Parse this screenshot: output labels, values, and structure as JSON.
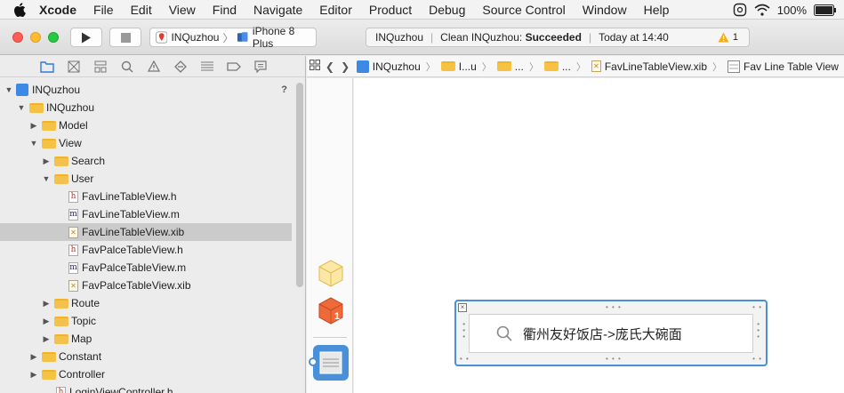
{
  "menubar": {
    "app_name": "Xcode",
    "items": [
      "File",
      "Edit",
      "View",
      "Find",
      "Navigate",
      "Editor",
      "Product",
      "Debug",
      "Source Control",
      "Window",
      "Help"
    ],
    "battery": "100%"
  },
  "toolbar": {
    "scheme": "INQuzhou",
    "device": "iPhone 8 Plus",
    "status_project": "INQuzhou",
    "status_action": "Clean INQuzhou:",
    "status_result": "Succeeded",
    "status_time": "Today at 14:40",
    "warning_count": "1"
  },
  "navigator": {
    "rows": [
      {
        "label": "INQuzhou",
        "type": "project",
        "indent": 0,
        "expanded": true,
        "selected": false
      },
      {
        "label": "INQuzhou",
        "type": "folder",
        "indent": 1,
        "expanded": true,
        "selected": false
      },
      {
        "label": "Model",
        "type": "folder",
        "indent": 2,
        "expanded": false,
        "selected": false
      },
      {
        "label": "View",
        "type": "folder",
        "indent": 2,
        "expanded": true,
        "selected": false
      },
      {
        "label": "Search",
        "type": "group",
        "indent": 3,
        "expanded": false,
        "selected": false
      },
      {
        "label": "User",
        "type": "group",
        "indent": 3,
        "expanded": true,
        "selected": false
      },
      {
        "label": "FavLineTableView.h",
        "type": "h",
        "indent": 4,
        "selected": false
      },
      {
        "label": "FavLineTableView.m",
        "type": "m",
        "indent": 4,
        "selected": false
      },
      {
        "label": "FavLineTableView.xib",
        "type": "xib",
        "indent": 4,
        "selected": true
      },
      {
        "label": "FavPalceTableView.h",
        "type": "h",
        "indent": 4,
        "selected": false
      },
      {
        "label": "FavPalceTableView.m",
        "type": "m",
        "indent": 4,
        "selected": false
      },
      {
        "label": "FavPalceTableView.xib",
        "type": "xib",
        "indent": 4,
        "selected": false
      },
      {
        "label": "Route",
        "type": "group",
        "indent": 3,
        "expanded": false,
        "selected": false
      },
      {
        "label": "Topic",
        "type": "group",
        "indent": 3,
        "expanded": false,
        "selected": false
      },
      {
        "label": "Map",
        "type": "group",
        "indent": 3,
        "expanded": false,
        "selected": false
      },
      {
        "label": "Constant",
        "type": "folder",
        "indent": 2,
        "expanded": false,
        "selected": false
      },
      {
        "label": "Controller",
        "type": "folder",
        "indent": 2,
        "expanded": false,
        "selected": false
      },
      {
        "label": "LoginViewController.h",
        "type": "h",
        "indent": 3,
        "selected": false
      }
    ],
    "badge": "?"
  },
  "jumpbar": {
    "crumbs": [
      "INQuzhou",
      "I...u",
      "...",
      "...",
      "FavLineTableView.xib",
      "Fav Line Table View"
    ]
  },
  "canvas": {
    "search_text": "衢州友好饭店->庞氏大碗面"
  },
  "colors": {
    "selection": "#cbcbcb",
    "accent": "#4a90d9",
    "folder": "#f5c244",
    "warning": "#f2b01e"
  }
}
